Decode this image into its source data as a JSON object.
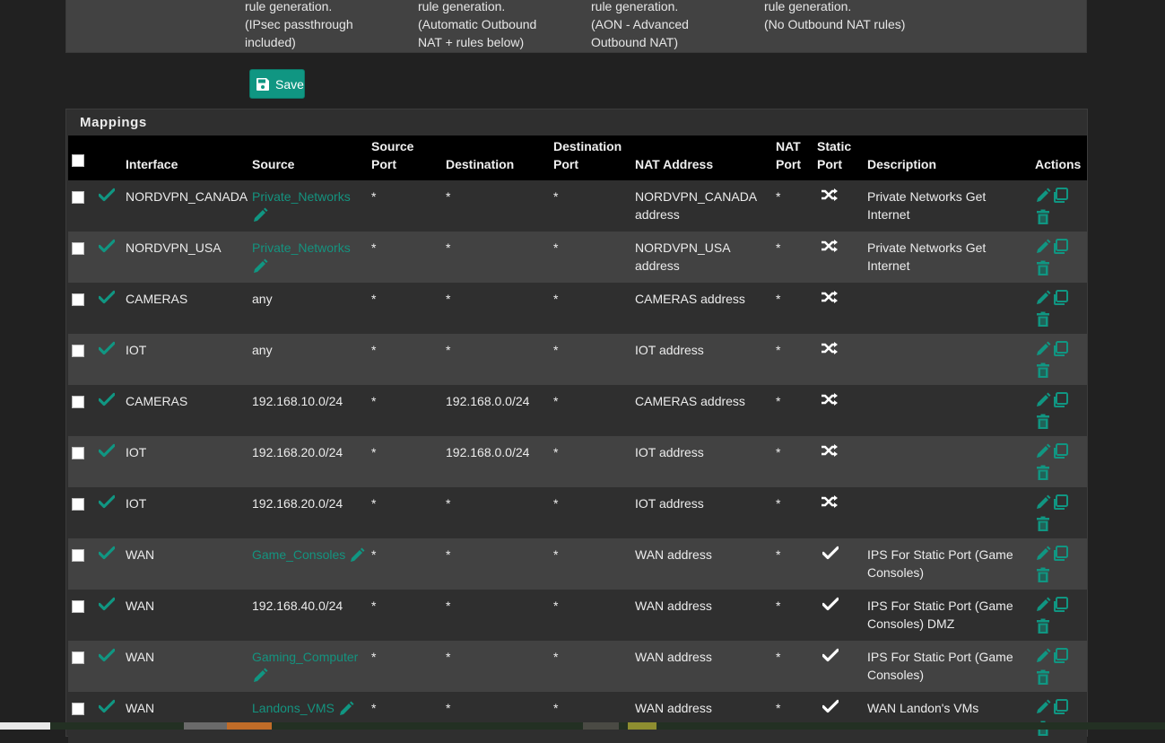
{
  "outbound_modes": [
    {
      "line1": "rule generation.",
      "line2": "(IPsec passthrough",
      "line3": "included)"
    },
    {
      "line1": "rule generation.",
      "line2": "(Automatic Outbound",
      "line3": "NAT + rules below)"
    },
    {
      "line1": "rule generation.",
      "line2": "(AON - Advanced",
      "line3": "Outbound NAT)"
    },
    {
      "line1": "rule generation.",
      "line2": "(No Outbound NAT rules)",
      "line3": ""
    }
  ],
  "save_button": {
    "label": "Save",
    "icon": "floppy-disk-icon"
  },
  "mappings": {
    "title": "Mappings",
    "columns": {
      "interface": "Interface",
      "source": "Source",
      "source_port_1": "Source",
      "source_port_2": "Port",
      "destination": "Destination",
      "destination_port_1": "Destination",
      "destination_port_2": "Port",
      "nat_address": "NAT Address",
      "nat_port_1": "NAT",
      "nat_port_2": "Port",
      "static_port_1": "Static",
      "static_port_2": "Port",
      "description": "Description",
      "actions": "Actions"
    },
    "rows": [
      {
        "interface": "NORDVPN_CANADA",
        "source": "Private_Networks",
        "source_is_alias": true,
        "source_port": "*",
        "destination": "*",
        "destination_port": "*",
        "nat_address": "NORDVPN_CANADA address",
        "nat_port": "*",
        "static_port": "shuffle-icon",
        "description": "Private Networks Get Internet"
      },
      {
        "interface": "NORDVPN_USA",
        "source": "Private_Networks",
        "source_is_alias": true,
        "source_port": "*",
        "destination": "*",
        "destination_port": "*",
        "nat_address": "NORDVPN_USA address",
        "nat_port": "*",
        "static_port": "shuffle-icon",
        "description": "Private Networks Get Internet"
      },
      {
        "interface": "CAMERAS",
        "source": "any",
        "source_is_alias": false,
        "source_port": "*",
        "destination": "*",
        "destination_port": "*",
        "nat_address": "CAMERAS address",
        "nat_port": "*",
        "static_port": "shuffle-icon",
        "description": ""
      },
      {
        "interface": "IOT",
        "source": "any",
        "source_is_alias": false,
        "source_port": "*",
        "destination": "*",
        "destination_port": "*",
        "nat_address": "IOT address",
        "nat_port": "*",
        "static_port": "shuffle-icon",
        "description": ""
      },
      {
        "interface": "CAMERAS",
        "source": "192.168.10.0/24",
        "source_is_alias": false,
        "source_port": "*",
        "destination": "192.168.0.0/24",
        "destination_port": "*",
        "nat_address": "CAMERAS address",
        "nat_port": "*",
        "static_port": "shuffle-icon",
        "description": ""
      },
      {
        "interface": "IOT",
        "source": "192.168.20.0/24",
        "source_is_alias": false,
        "source_port": "*",
        "destination": "192.168.0.0/24",
        "destination_port": "*",
        "nat_address": "IOT address",
        "nat_port": "*",
        "static_port": "shuffle-icon",
        "description": ""
      },
      {
        "interface": "IOT",
        "source": "192.168.20.0/24",
        "source_is_alias": false,
        "source_port": "*",
        "destination": "*",
        "destination_port": "*",
        "nat_address": "IOT address",
        "nat_port": "*",
        "static_port": "shuffle-icon",
        "description": ""
      },
      {
        "interface": "WAN",
        "source": "Game_Consoles",
        "source_is_alias": true,
        "source_port": "*",
        "destination": "*",
        "destination_port": "*",
        "nat_address": "WAN address",
        "nat_port": "*",
        "static_port": "check-icon",
        "description": "IPS For Static Port (Game Consoles)"
      },
      {
        "interface": "WAN",
        "source": "192.168.40.0/24",
        "source_is_alias": false,
        "source_port": "*",
        "destination": "*",
        "destination_port": "*",
        "nat_address": "WAN address",
        "nat_port": "*",
        "static_port": "check-icon",
        "description": "IPS For Static Port (Game Consoles) DMZ"
      },
      {
        "interface": "WAN",
        "source": "Gaming_Computer",
        "source_is_alias": true,
        "source_port": "*",
        "destination": "*",
        "destination_port": "*",
        "nat_address": "WAN address",
        "nat_port": "*",
        "static_port": "check-icon",
        "description": "IPS For Static Port (Game Consoles)"
      },
      {
        "interface": "WAN",
        "source": "Landons_VMS",
        "source_is_alias": true,
        "source_port": "*",
        "destination": "*",
        "destination_port": "*",
        "nat_address": "WAN address",
        "nat_port": "*",
        "static_port": "check-icon",
        "description": "WAN Landon's VMs"
      }
    ]
  },
  "colors": {
    "accent": "#109682",
    "link": "#14937f",
    "header_bg": "#000000",
    "row_odd": "#2f2f2f",
    "row_even": "#424242"
  }
}
